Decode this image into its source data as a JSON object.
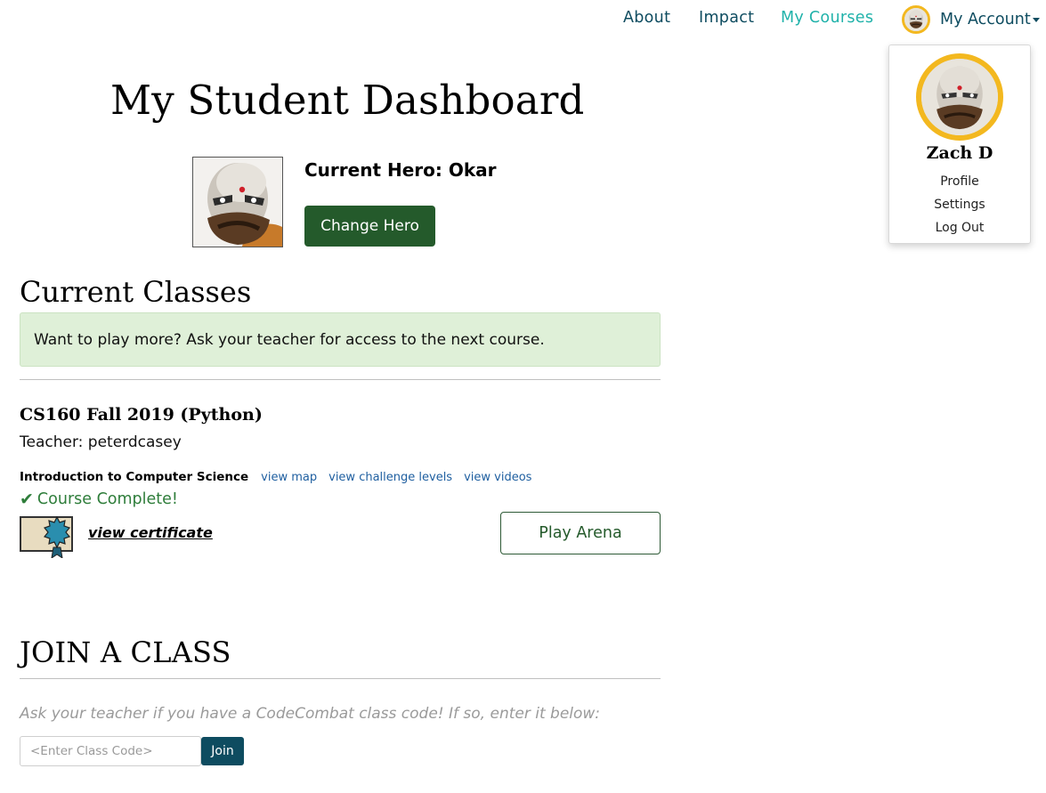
{
  "nav": {
    "about": "About",
    "impact": "Impact",
    "my_courses": "My Courses",
    "my_account": "My Account"
  },
  "dropdown": {
    "user_name": "Zach D",
    "items": [
      "Profile",
      "Settings",
      "Log Out"
    ]
  },
  "page": {
    "title": "My Student Dashboard"
  },
  "hero": {
    "label": "Current Hero: Okar",
    "change_button": "Change Hero"
  },
  "classes": {
    "heading": "Current Classes",
    "alert": "Want to play more? Ask your teacher for access to the next course.",
    "items": [
      {
        "name": "CS160 Fall 2019 (Python)",
        "teacher": "Teacher: peterdcasey",
        "course": "Introduction to Computer Science",
        "links": [
          "view map",
          "view challenge levels",
          "view videos"
        ],
        "status": "Course Complete!",
        "certificate_link": "view certificate",
        "arena_button": "Play Arena"
      }
    ]
  },
  "join": {
    "heading": "JOIN A CLASS",
    "hint": "Ask your teacher if you have a CodeCombat class code! If so, enter it below:",
    "input_value": "",
    "input_placeholder": "<Enter Class Code>",
    "button": "Join"
  },
  "colors": {
    "nav_text": "#0e4c60",
    "nav_active": "#20b2aa",
    "primary_green": "#245a2b",
    "alert_bg": "#dff0d8",
    "avatar_ring": "#f3b81f",
    "join_button": "#0e4c60"
  },
  "icons": {
    "avatar": "hero-okar-avatar",
    "status": "checkmark-icon",
    "certificate": "certificate-ribbon-icon"
  }
}
